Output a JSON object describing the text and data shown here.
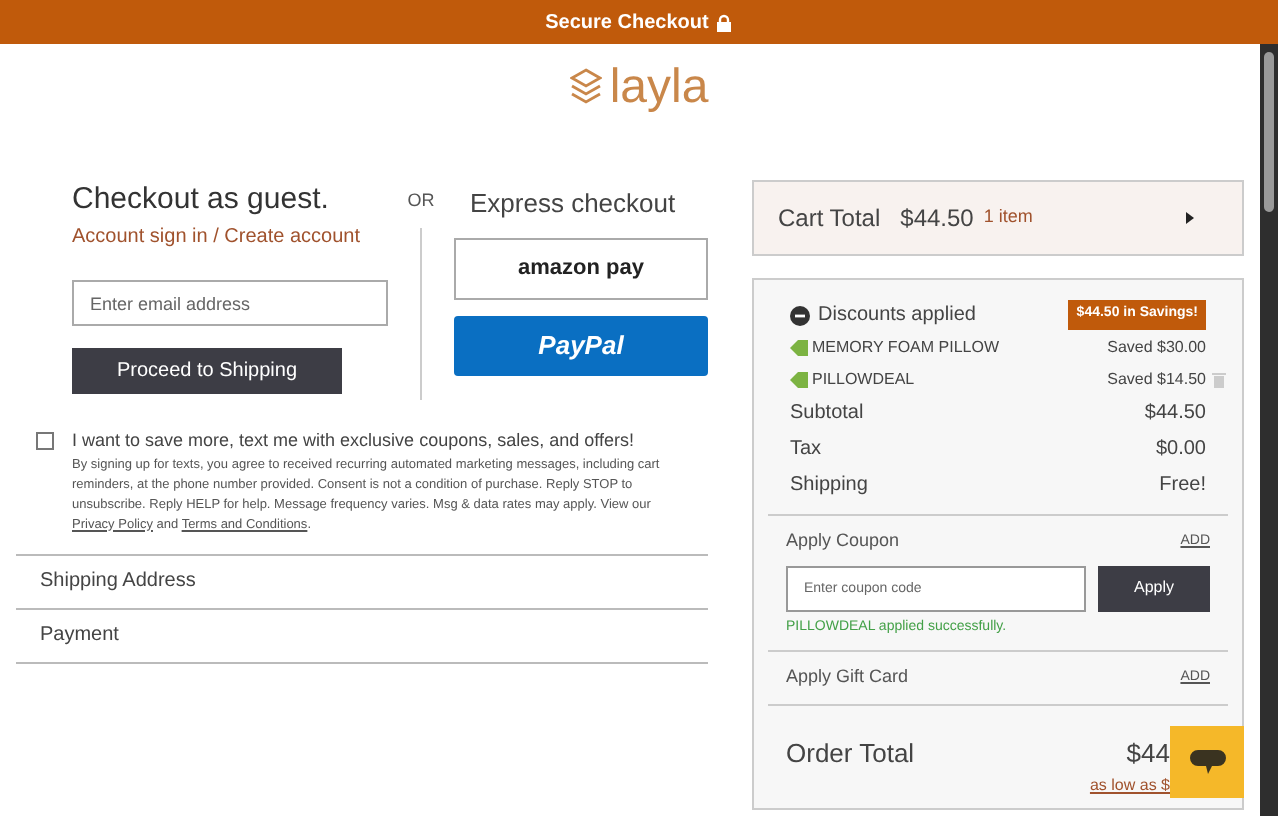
{
  "top_bar": {
    "text": "Secure Checkout"
  },
  "logo": {
    "text": "layla"
  },
  "guest": {
    "title": "Checkout as guest.",
    "account_link": "Account sign in / Create account",
    "email_placeholder": "Enter email address",
    "proceed_button": "Proceed to Shipping"
  },
  "or_label": "OR",
  "express": {
    "title": "Express checkout",
    "amazon_label": "amazon pay",
    "paypal_label": "PayPal"
  },
  "sms_optin": {
    "checked": false,
    "label": "I want to save more, text me with exclusive coupons, sales, and offers!",
    "disclaimer": "By signing up for texts, you agree to received recurring automated marketing messages, including cart reminders, at the phone number provided. Consent is not a condition of purchase. Reply STOP to unsubscribe. Reply HELP for help. Message frequency varies. Msg & data rates may apply. View our",
    "privacy_link": "Privacy Policy",
    "and_text": "and",
    "terms_link": "Terms and Conditions",
    "end_text": "."
  },
  "sections": [
    {
      "label": "Shipping Address"
    },
    {
      "label": "Payment"
    }
  ],
  "cart_total": {
    "label": "Cart Total",
    "amount": "$44.50",
    "items": "1 item"
  },
  "summary": {
    "discounts_title": "Discounts applied",
    "savings_badge": "$44.50 in Savings!",
    "discounts": [
      {
        "name": "MEMORY FOAM PILLOW",
        "amount": "Saved $30.00",
        "removable": false
      },
      {
        "name": "PILLOWDEAL",
        "amount": "Saved $14.50",
        "removable": true
      }
    ],
    "lines": [
      {
        "label": "Subtotal",
        "value": "$44.50"
      },
      {
        "label": "Tax",
        "value": "$0.00"
      },
      {
        "label": "Shipping",
        "value": "Free!"
      }
    ],
    "coupon": {
      "title": "Apply Coupon",
      "add": "ADD",
      "placeholder": "Enter coupon code",
      "button": "Apply",
      "message": "PILLOWDEAL applied successfully."
    },
    "gift_card": {
      "title": "Apply Gift Card",
      "add": "ADD"
    },
    "order_total": {
      "label": "Order Total",
      "amount": "$44",
      "financing": "as low as $"
    }
  }
}
